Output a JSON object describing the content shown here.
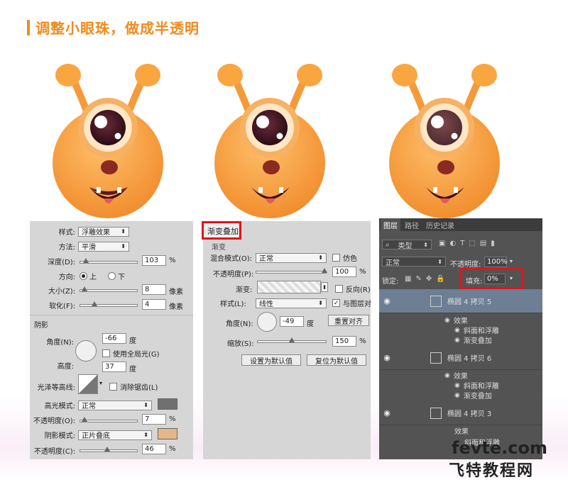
{
  "header": {
    "title": "调整小眼珠，做成半透明"
  },
  "colors": {
    "accent": "#f08a1c",
    "highlight_box": "#e0141e",
    "monster_body": "#f5a54a",
    "shadow_swatch": "#e5b787",
    "gloss_swatch": "#707070"
  },
  "bevel": {
    "style_label": "样式:",
    "style_value": "浮雕效果",
    "method_label": "方法:",
    "method_value": "平滑",
    "depth_label": "深度(D):",
    "depth_value": "103",
    "depth_unit": "%",
    "direction_label": "方向:",
    "dir_up": "上",
    "dir_down": "下",
    "size_label": "大小(Z):",
    "size_value": "8",
    "size_unit": "像素",
    "soften_label": "软化(F):",
    "soften_value": "4",
    "soften_unit": "像素",
    "shading_title": "阴影",
    "angle_label": "角度(N):",
    "angle_value": "-66",
    "angle_unit": "度",
    "global_light": "使用全局光(G)",
    "altitude_label": "高度:",
    "altitude_value": "37",
    "altitude_unit": "度",
    "gloss_label": "光泽等高线:",
    "antialias": "消除锯齿(L)",
    "highlight_label": "高光模式:",
    "highlight_value": "正常",
    "hl_opacity_label": "不透明度(O):",
    "hl_opacity_value": "7",
    "hl_opacity_unit": "%",
    "shadow_label": "阴影模式:",
    "shadow_value": "正片叠底",
    "sh_opacity_label": "不透明度(C):",
    "sh_opacity_value": "46",
    "sh_opacity_unit": "%"
  },
  "gradient": {
    "title": "渐变叠加",
    "subtitle": "渐变",
    "blend_label": "混合模式(O):",
    "blend_value": "正常",
    "dither": "仿色",
    "opacity_label": "不透明度(P):",
    "opacity_value": "100",
    "opacity_unit": "%",
    "gradient_label": "渐变:",
    "reverse": "反向(R)",
    "style_label": "样式(L):",
    "style_value": "线性",
    "align": "与图层对",
    "angle_label": "角度(N):",
    "angle_value": "-49",
    "angle_unit": "度",
    "reset_align": "重置对齐",
    "scale_label": "缩放(S):",
    "scale_value": "150",
    "scale_unit": "%",
    "set_default": "设置为默认值",
    "reset_default": "复位为默认值"
  },
  "layers": {
    "tabs": [
      "图层",
      "路径",
      "历史记录"
    ],
    "filter": "类型",
    "blend": "正常",
    "opacity_label": "不透明度:",
    "opacity_value": "100%",
    "lock_label": "锁定:",
    "fill_label": "填充:",
    "fill_value": "0%",
    "items": [
      {
        "name": "椭圆 4 拷贝 5",
        "effects": "效果",
        "bevel": "斜面和浮雕",
        "grad": "渐变叠加"
      },
      {
        "name": "椭圆 4 拷贝 6",
        "effects": "效果",
        "bevel": "斜面和浮雕",
        "grad": "渐变叠加"
      },
      {
        "name": "椭圆 4 拷贝 3",
        "effects": "效果",
        "bevel": "斜面和浮雕"
      }
    ]
  },
  "watermark": {
    "line1": "fevte.com",
    "line2": "飞特教程网"
  }
}
